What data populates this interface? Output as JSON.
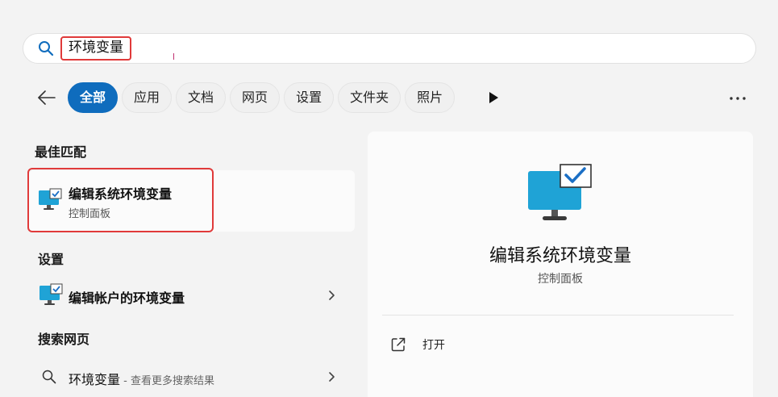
{
  "search": {
    "query": "环境变量"
  },
  "filters": [
    {
      "label": "全部",
      "active": true
    },
    {
      "label": "应用",
      "active": false
    },
    {
      "label": "文档",
      "active": false
    },
    {
      "label": "网页",
      "active": false
    },
    {
      "label": "设置",
      "active": false
    },
    {
      "label": "文件夹",
      "active": false
    },
    {
      "label": "照片",
      "active": false
    }
  ],
  "sections": {
    "best_match": "最佳匹配",
    "settings": "设置",
    "web": "搜索网页"
  },
  "best_match": {
    "title": "编辑系统环境变量",
    "subtitle": "控制面板"
  },
  "settings_items": [
    {
      "title": "编辑帐户的环境变量"
    }
  ],
  "web_items": [
    {
      "query": "环境变量",
      "hint": " - 查看更多搜索结果"
    }
  ],
  "detail": {
    "title": "编辑系统环境变量",
    "subtitle": "控制面板",
    "actions": [
      {
        "label": "打开",
        "icon": "open-external-icon"
      }
    ]
  },
  "colors": {
    "accent": "#0f6cbd",
    "highlight": "#e03a3a",
    "monitor": "#1fa3d6"
  }
}
